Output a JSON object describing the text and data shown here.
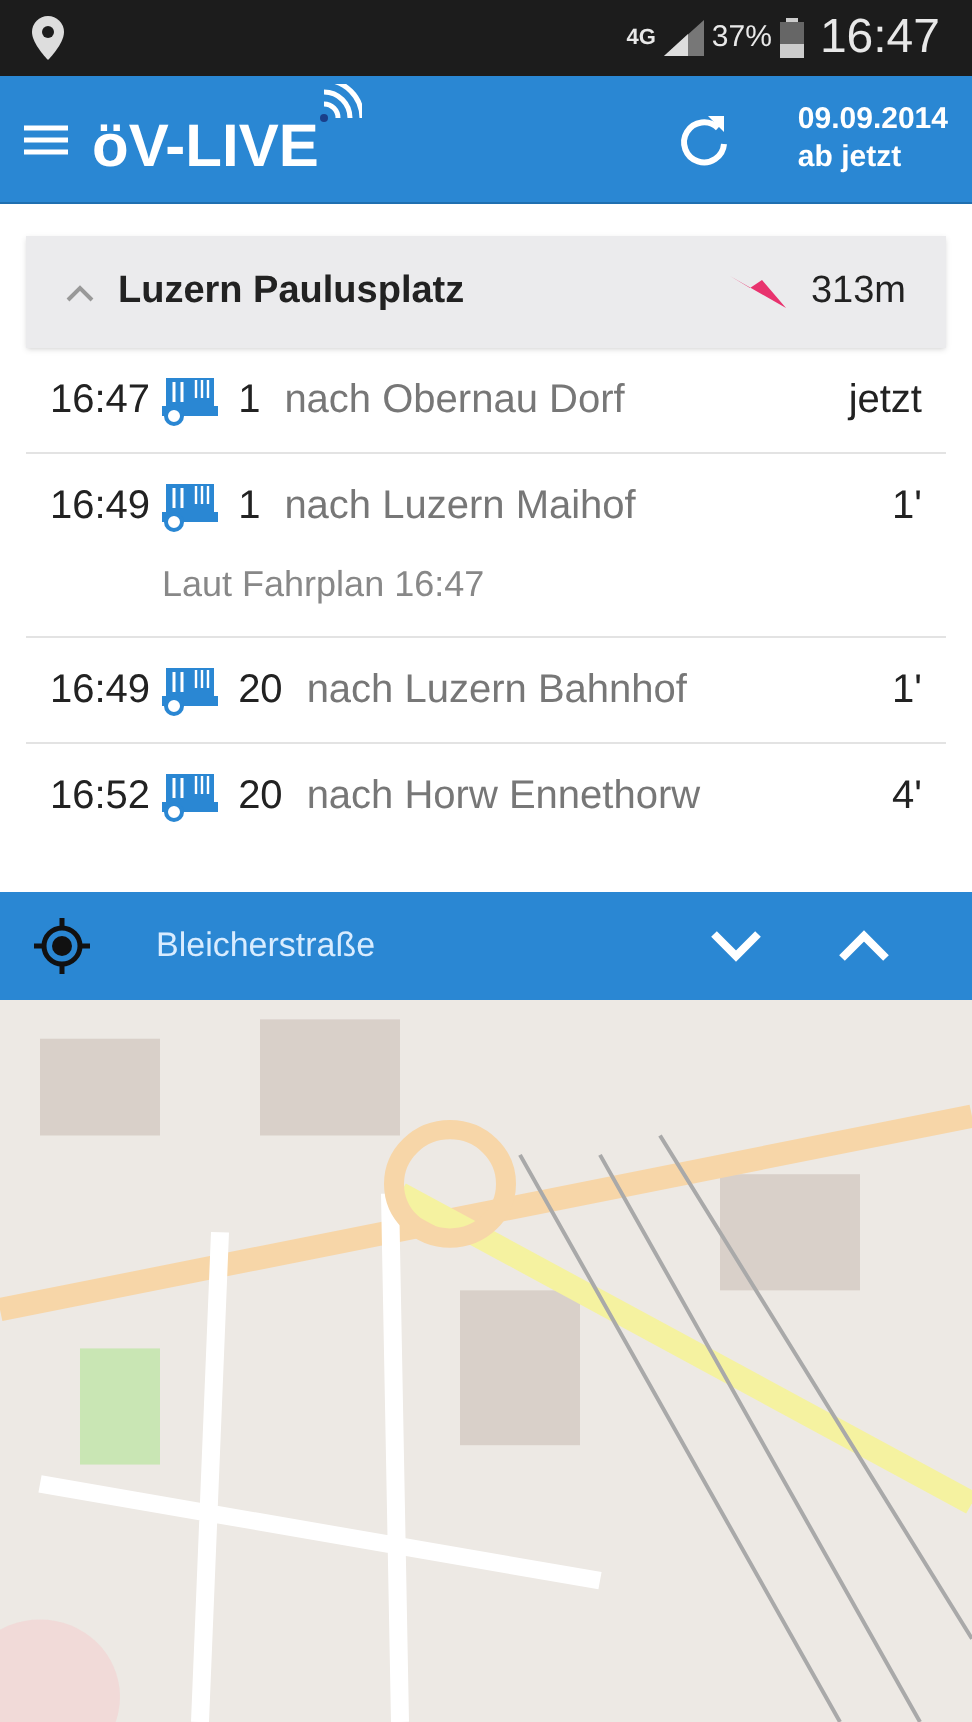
{
  "status_bar": {
    "network": "4G",
    "battery": "37%",
    "time": "16:47"
  },
  "app_bar": {
    "logo": "öV-LIVE",
    "date": "09.09.2014",
    "period": "ab jetzt"
  },
  "station": {
    "name": "Luzern Paulusplatz",
    "expanded": true,
    "distance": "313m"
  },
  "departures": [
    {
      "time": "16:47",
      "line": "1",
      "destination": "nach Obernau Dorf",
      "wait": "jetzt"
    },
    {
      "time": "16:49",
      "line": "1",
      "destination": "nach Luzern Maihof",
      "wait": "1'",
      "note": "Laut Fahrplan 16:47"
    },
    {
      "time": "16:49",
      "line": "20",
      "destination": "nach Luzern Bahnhof",
      "wait": "1'"
    },
    {
      "time": "16:52",
      "line": "20",
      "destination": "nach Horw Ennethorw",
      "wait": "4'"
    }
  ],
  "map_bar": {
    "street": "Bleicherstraße"
  }
}
